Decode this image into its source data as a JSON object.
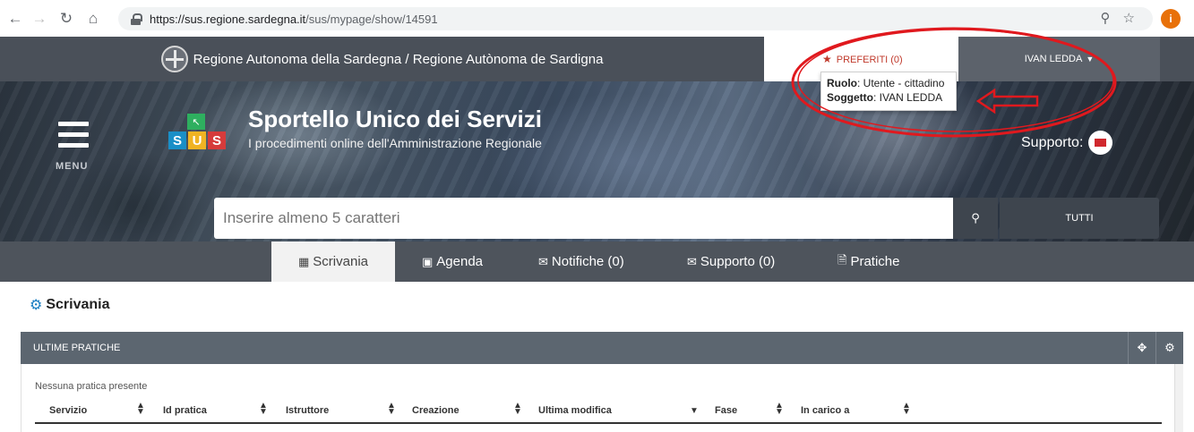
{
  "browser": {
    "url_host": "https://sus.regione.sardegna.it",
    "url_path": "/sus/mypage/show/14591",
    "profile_initial": "i"
  },
  "topbar": {
    "region_title": "Regione Autonoma della Sardegna / Regione Autònoma de Sardigna",
    "favorites_label": "PREFERITI (0)",
    "user_name": "IVAN LEDDA"
  },
  "tooltip": {
    "role_label": "Ruolo",
    "role_value": ": Utente - cittadino",
    "subject_label": "Soggetto",
    "subject_value": ": IVAN LEDDA"
  },
  "hero": {
    "menu_label": "MENU",
    "logo_letters": [
      "S",
      "U",
      "S"
    ],
    "title": "Sportello Unico dei Servizi",
    "subtitle": "I procedimenti online dell'Amministrazione Regionale",
    "support_label": "Supporto:",
    "search_placeholder": "Inserire almeno 5 caratteri",
    "all_button": "TUTTI"
  },
  "nav": {
    "tabs": [
      {
        "label": "Scrivania",
        "icon": "grid-icon"
      },
      {
        "label": "Agenda",
        "icon": "contact-book-icon"
      },
      {
        "label": "Notifiche (0)",
        "icon": "envelope-icon"
      },
      {
        "label": "Supporto (0)",
        "icon": "envelope-icon"
      },
      {
        "label": "Pratiche",
        "icon": "document-icon"
      }
    ]
  },
  "page": {
    "title": "Scrivania"
  },
  "panel": {
    "title": "ULTIME PRATICHE",
    "empty_message": "Nessuna pratica presente",
    "columns": [
      "Servizio",
      "Id pratica",
      "Istruttore",
      "Creazione",
      "Ultima modifica",
      "Fase",
      "In carico a"
    ]
  },
  "colors": {
    "topbar": "#4a5059",
    "navbar": "#4e545c",
    "accent_red": "#c0392b",
    "annotation_red": "#e0191e",
    "panel_header": "#5c6670"
  }
}
